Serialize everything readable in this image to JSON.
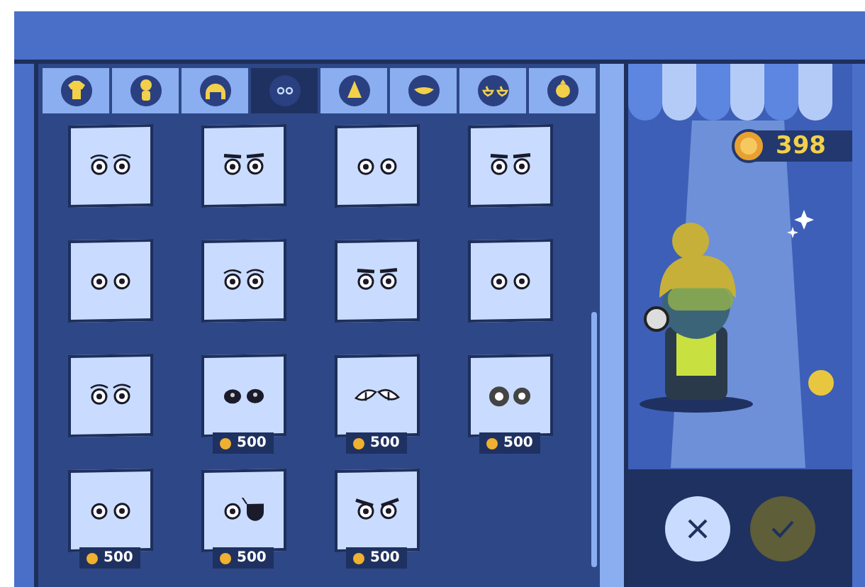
{
  "tabs": [
    {
      "kind": "shirt",
      "selected": false
    },
    {
      "kind": "body",
      "selected": false
    },
    {
      "kind": "hair",
      "selected": false
    },
    {
      "kind": "eyes",
      "selected": true
    },
    {
      "kind": "nose",
      "selected": false
    },
    {
      "kind": "mouth",
      "selected": false
    },
    {
      "kind": "glasses",
      "selected": false
    },
    {
      "kind": "face",
      "selected": false
    }
  ],
  "items": [
    {
      "kind": "lashes"
    },
    {
      "kind": "brows"
    },
    {
      "kind": "plain"
    },
    {
      "kind": "brows"
    },
    {
      "kind": "plain"
    },
    {
      "kind": "lashes"
    },
    {
      "kind": "brows"
    },
    {
      "kind": "plain"
    },
    {
      "kind": "lashes"
    },
    {
      "kind": "dark",
      "price": "500"
    },
    {
      "kind": "cat",
      "price": "500"
    },
    {
      "kind": "ring",
      "price": "500"
    },
    {
      "kind": "plain",
      "price": "500"
    },
    {
      "kind": "patch",
      "price": "500"
    },
    {
      "kind": "angry",
      "price": "500"
    }
  ],
  "coins": "398"
}
